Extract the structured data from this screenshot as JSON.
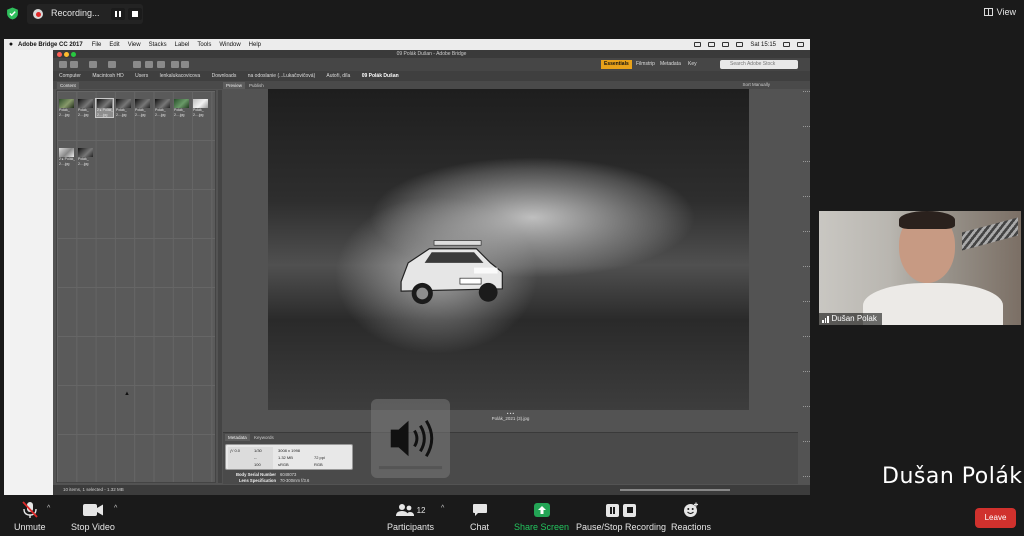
{
  "zoom": {
    "recording_label": "Recording...",
    "view_label": "View",
    "toolbar": {
      "unmute": "Unmute",
      "stop_video": "Stop Video",
      "participants": "Participants",
      "participants_count": "12",
      "chat": "Chat",
      "share_screen": "Share Screen",
      "pause_stop_recording": "Pause/Stop Recording",
      "reactions": "Reactions",
      "leave": "Leave"
    },
    "participant": {
      "tile_name": "Dušan Polak",
      "big_name": "Dušan Polák"
    },
    "colors": {
      "share_green": "#23a455",
      "leave_red": "#d0312d",
      "record_red": "#e02828"
    }
  },
  "mac_menubar": {
    "app_name": "Adobe Bridge CC 2017",
    "items": [
      "File",
      "Edit",
      "View",
      "Stacks",
      "Label",
      "Tools",
      "Window",
      "Help"
    ],
    "clock": "Sat 15:15"
  },
  "bridge": {
    "window_title": "09 Polák Dušan - Adobe Bridge",
    "workspaces": [
      "Essentials",
      "Filmstrip",
      "Metadata",
      "Key"
    ],
    "search_placeholder": "Search Adobe Stock",
    "sort_label": "Sort Manually",
    "path": [
      "Computer",
      "Macintosh HD",
      "Users",
      "lenkalukacovicova",
      "Downloads",
      "na odoslanie (...Lukačovičová)",
      "Autoři, díla",
      "09 Polák Dušan"
    ],
    "panel_tabs": [
      "Content",
      "Preview",
      "Publish"
    ],
    "thumbnails": [
      {
        "c1": "Polák_",
        "c2": "2....jpg"
      },
      {
        "c1": "Polák_",
        "c2": "2....jpg"
      },
      {
        "c1": "2 ▸ Polák_",
        "c2": "2....jpg"
      },
      {
        "c1": "Polák_",
        "c2": "2....jpg"
      },
      {
        "c1": "Polák_",
        "c2": "2....jpg"
      },
      {
        "c1": "Polák_",
        "c2": "2....jpg"
      },
      {
        "c1": "Polák_",
        "c2": "2....jpg"
      },
      {
        "c1": "Polák_",
        "c2": "2....jpg"
      },
      {
        "c1": "2 ▸ Polák_",
        "c2": "2....jpg"
      },
      {
        "c1": "Polák_",
        "c2": "2....jpg"
      }
    ],
    "preview_caption": "Polák_2021 (3).jpg",
    "preview_dots": "• • •",
    "meta_tabs": [
      "Metadata",
      "Keywords"
    ],
    "metadata_box": {
      "aperture": "ƒ/ 0.0",
      "shutter": "1/30",
      "dimensions": "3008 x 1998",
      "size": "1.32 MB",
      "ppi": "72 ppi",
      "color_space": "sRGB",
      "mode": "RGB",
      "dash": "--",
      "iso": "100"
    },
    "metadata_rows": [
      {
        "label": "Body Serial Number",
        "value": "6048073"
      },
      {
        "label": "Lens Specification",
        "value": "70-300mm f/3.6"
      }
    ],
    "status_text": "10 items, 1 selected - 1.32 MB"
  }
}
